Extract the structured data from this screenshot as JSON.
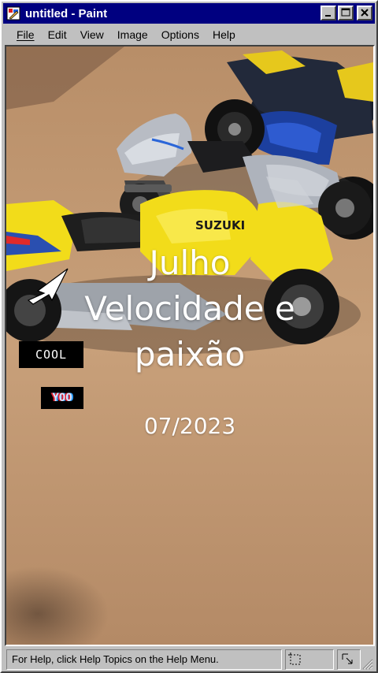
{
  "window": {
    "title": "untitled - Paint",
    "app_icon": "paint-icon",
    "title_buttons": [
      "minimize-icon",
      "maximize-icon",
      "close-icon"
    ]
  },
  "menu": {
    "items": [
      "File",
      "Edit",
      "View",
      "Image",
      "Options",
      "Help"
    ]
  },
  "canvas": {
    "overlay_title_lines": [
      "Julho",
      "Velocidade e",
      "paixão"
    ],
    "overlay_date": "07/2023",
    "sticker_cool": "COOL",
    "sticker_yoo": "YOO",
    "bike_brand": "SUZUKI",
    "colors": {
      "floor": "#c49a73",
      "bike_yellow": "#f2dc1a",
      "bike_silver": "#b8bcc4",
      "bike_blue": "#1c3f9e"
    }
  },
  "statusbar": {
    "help_text": "For Help, click Help Topics on the Help Menu.",
    "icons": [
      "selection-size-icon",
      "cursor-position-icon",
      "resize-grip-icon"
    ]
  }
}
